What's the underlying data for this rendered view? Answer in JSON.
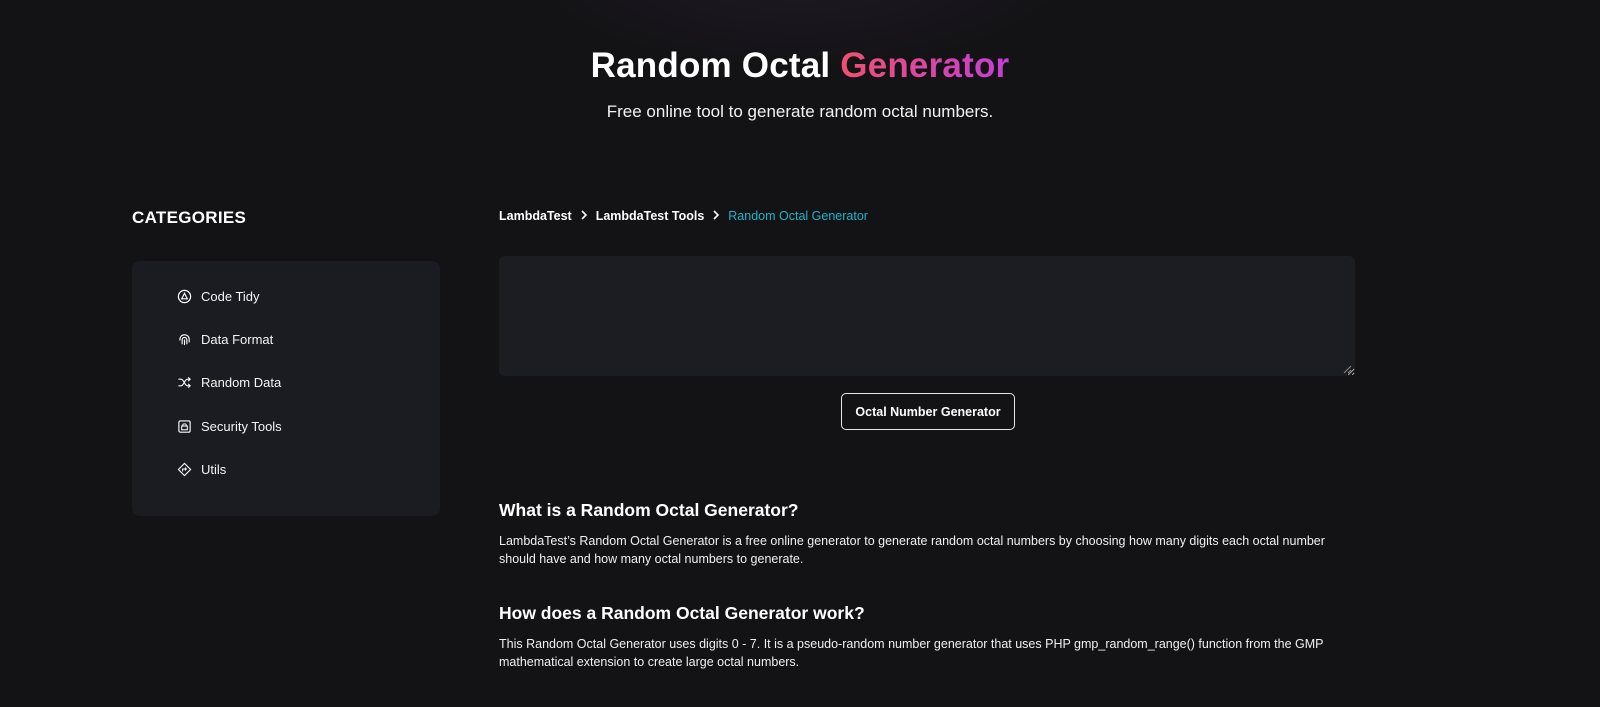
{
  "hero": {
    "title_part1": "Random Octal",
    "title_part2": "Generator",
    "subtitle": "Free online tool to generate random octal numbers."
  },
  "sidebar": {
    "title": "CATEGORIES",
    "items": [
      {
        "label": "Code Tidy",
        "icon": "code-tidy-icon"
      },
      {
        "label": "Data Format",
        "icon": "fingerprint-icon"
      },
      {
        "label": "Random Data",
        "icon": "shuffle-icon"
      },
      {
        "label": "Security Tools",
        "icon": "lock-box-icon"
      },
      {
        "label": "Utils",
        "icon": "diamond-arrow-icon"
      }
    ]
  },
  "breadcrumb": {
    "items": [
      "LambdaTest",
      "LambdaTest Tools"
    ],
    "current": "Random Octal Generator"
  },
  "output": {
    "value": ""
  },
  "button": {
    "label": "Octal Number Generator"
  },
  "sections": [
    {
      "heading": "What is a Random Octal Generator?",
      "text": "LambdaTest’s Random Octal Generator is a free online generator to generate random octal numbers by choosing how many digits each octal number should have and how many octal numbers to generate."
    },
    {
      "heading": "How does a Random Octal Generator work?",
      "text": "This Random Octal Generator uses digits 0 - 7. It is a pseudo-random number generator that uses PHP gmp_random_range() function from the GMP mathematical extension to create large octal numbers."
    }
  ],
  "colors": {
    "background": "#131316",
    "panel": "#1b1b22",
    "accent_gradient_start": "#f0506e",
    "accent_gradient_end": "#c33fd6",
    "breadcrumb_current": "#1fb3c8"
  }
}
